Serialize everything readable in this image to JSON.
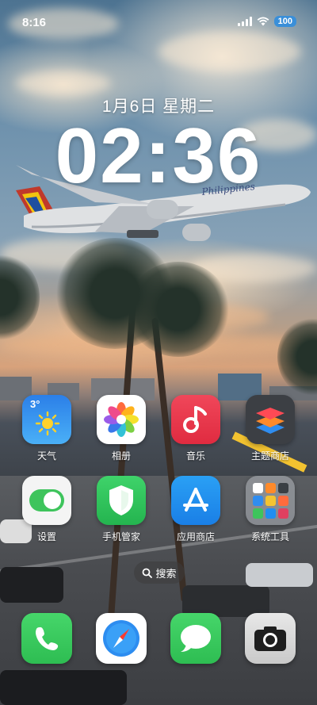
{
  "status_bar": {
    "time": "8:16",
    "battery": "100"
  },
  "lockscreen": {
    "date": "1月6日 星期二",
    "clock": "02:36"
  },
  "apps": [
    {
      "name": "weather",
      "label": "天气",
      "icon": "weather-icon"
    },
    {
      "name": "gallery",
      "label": "相册",
      "icon": "photos-icon"
    },
    {
      "name": "music",
      "label": "音乐",
      "icon": "music-icon"
    },
    {
      "name": "theme-store",
      "label": "主题商店",
      "icon": "themes-icon"
    },
    {
      "name": "settings",
      "label": "设置",
      "icon": "toggle-icon"
    },
    {
      "name": "phone-manager",
      "label": "手机管家",
      "icon": "shield-icon"
    },
    {
      "name": "app-store",
      "label": "应用商店",
      "icon": "app-store-icon"
    },
    {
      "name": "system-tools",
      "label": "系统工具",
      "icon": "folder-icon"
    }
  ],
  "weather_widget": {
    "temp": "3°"
  },
  "search": {
    "label": "搜索"
  },
  "dock": [
    {
      "name": "phone",
      "icon": "phone-icon"
    },
    {
      "name": "browser",
      "icon": "compass-icon"
    },
    {
      "name": "messages",
      "icon": "message-icon"
    },
    {
      "name": "camera",
      "icon": "camera-icon"
    }
  ],
  "colors": {
    "weather_bg": "#2f8ff0",
    "music_bg": "#ee3b4e",
    "settings_bg": "#f4f4f4",
    "phone_manager_bg": "#2cc65a",
    "app_store_bg": "#1f8ef1",
    "phone_bg": "#35c759",
    "messages_bg": "#35c759",
    "camera_bg": "#d7d7d7"
  }
}
